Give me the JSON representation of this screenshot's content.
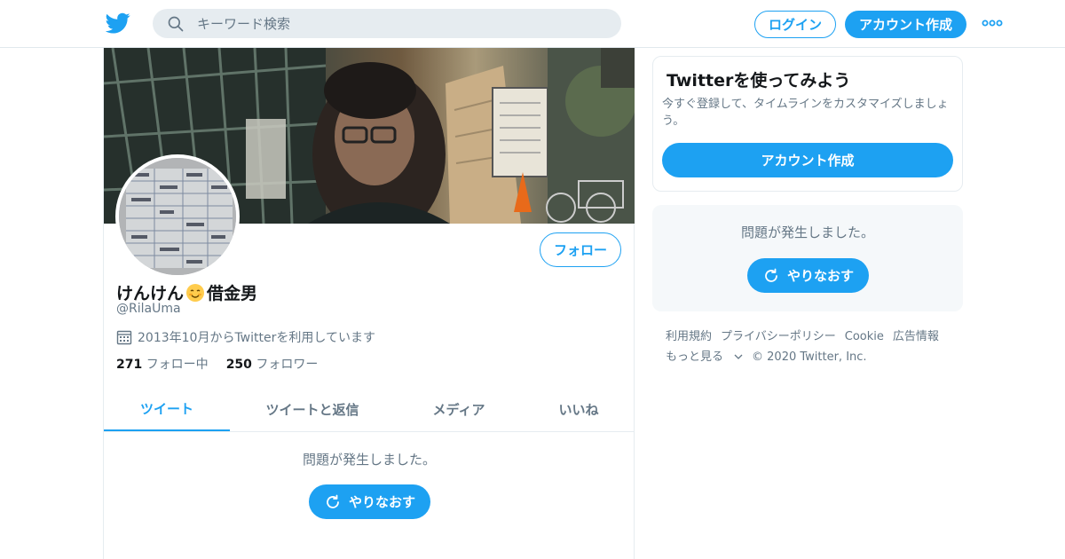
{
  "header": {
    "search_placeholder": "キーワード検索",
    "login_label": "ログイン",
    "signup_label": "アカウント作成"
  },
  "profile": {
    "display_name": "けんけん",
    "display_name_suffix": "借金男",
    "name_emoji": "smiling-face-emoji",
    "handle": "@RilaUma",
    "joined": "2013年10月からTwitterを利用しています",
    "following_count": "271",
    "following_label": "フォロー中",
    "followers_count": "250",
    "followers_label": "フォロワー",
    "follow_label": "フォロー"
  },
  "tabs": [
    {
      "label": "ツイート",
      "active": true
    },
    {
      "label": "ツイートと返信",
      "active": false
    },
    {
      "label": "メディア",
      "active": false
    },
    {
      "label": "いいね",
      "active": false
    }
  ],
  "timeline": {
    "error_text": "問題が発生しました。",
    "retry_label": "やりなおす"
  },
  "sidebar": {
    "signup_card": {
      "title": "Twitterを使ってみよう",
      "description": "今すぐ登録して、タイムラインをカスタマイズしましょう。",
      "button_label": "アカウント作成"
    },
    "error_card": {
      "error_text": "問題が発生しました。",
      "retry_label": "やりなおす"
    },
    "footer": {
      "terms": "利用規約",
      "privacy": "プライバシーポリシー",
      "cookie": "Cookie",
      "ads": "広告情報",
      "more": "もっと見る",
      "copyright": "© 2020 Twitter, Inc."
    }
  },
  "colors": {
    "accent": "#1da1f2",
    "text_secondary": "#657786",
    "border": "#e6ecf0"
  },
  "icons": [
    "twitter-bird-icon",
    "search-icon",
    "more-dots-icon",
    "calendar-icon",
    "refresh-icon",
    "chevron-down-icon"
  ]
}
